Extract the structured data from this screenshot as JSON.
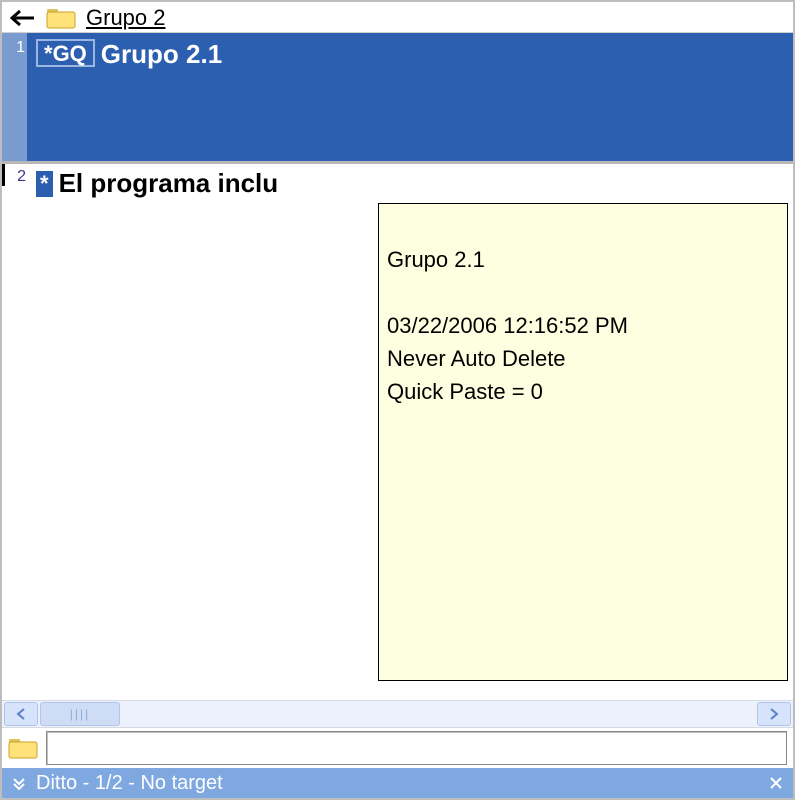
{
  "header": {
    "breadcrumb": "Grupo 2"
  },
  "list": {
    "items": [
      {
        "index": "1",
        "badge_star": "*",
        "badge_tag": "GQ",
        "text": "Grupo 2.1",
        "selected": true
      },
      {
        "index": "2",
        "badge_star": "*",
        "badge_tag": "",
        "text": "El programa inclu",
        "selected": false
      }
    ]
  },
  "tooltip": {
    "title": "Grupo 2.1",
    "timestamp": "03/22/2006 12:16:52 PM",
    "auto_delete": "Never Auto Delete",
    "quick_paste": "Quick Paste = 0"
  },
  "search": {
    "value": "",
    "placeholder": ""
  },
  "statusbar": {
    "text": "Ditto - 1/2 - No target"
  }
}
